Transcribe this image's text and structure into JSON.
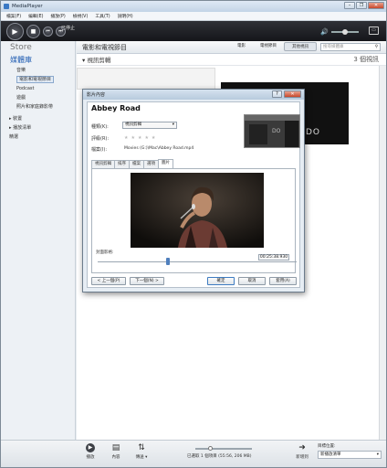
{
  "window": {
    "title": "MediaPlayer",
    "buttons": [
      "–",
      "❐",
      "✕"
    ]
  },
  "menu": [
    "檔案(F)",
    "編輯(E)",
    "播放(P)",
    "檢視(V)",
    "工具(T)",
    "說明(H)"
  ],
  "toolbar": {
    "status": "已停止",
    "play": "▶",
    "stop": "■",
    "prev": "⏮",
    "next": "⏭",
    "speaker": "🔊",
    "mini": "▭"
  },
  "sidebar": {
    "store": "Store",
    "library": "媒體庫",
    "items": [
      "音樂",
      "電影和電視節目",
      "Podcast",
      "遊戲",
      "照片和家庭錄影帶"
    ],
    "selected": "電影和電視節目",
    "groups": [
      "▸ 裝置",
      "▸ 播放清單",
      "精選"
    ]
  },
  "main": {
    "title": "電影和電視節目",
    "tabs": [
      "電影",
      "電視節目",
      "其他視訊"
    ],
    "active_tab": "其他視訊",
    "search_placeholder": "搜尋媒體庫",
    "section": "▾ 視訊剪輯",
    "count": "3 個視訊",
    "thumb_text": "DO"
  },
  "dialog": {
    "title": "影片內容",
    "name": "Abbey Road",
    "genre_label": "種類(K):",
    "genre_value": "視訊剪輯",
    "rating_label": "評級(R):",
    "rating_stars": "★★★★★",
    "file_label": "檔案(I):",
    "file_path": "Movies (G:)\\Mac\\Abbey Road.mp4",
    "tabs": [
      "視訊剪輯",
      "排序",
      "檔案",
      "選項",
      "圖片"
    ],
    "active_tab": "圖片",
    "cover_label": "封面影格:",
    "time": "00:25:38.930",
    "prev_button": "< 上一個(P)",
    "next_button": "下一個(N) >",
    "ok": "確定",
    "cancel": "取消",
    "apply": "套用(A)",
    "help": "?",
    "close": "✕"
  },
  "bottom": {
    "play": "播放",
    "contents": "內容",
    "sort": "傳送 ▾",
    "new_playlist": "新增到",
    "selection": "已選取 1 個項目 (55:56, 206 MB)",
    "target_label": "目標位置:",
    "target_value": "新播放清單"
  }
}
